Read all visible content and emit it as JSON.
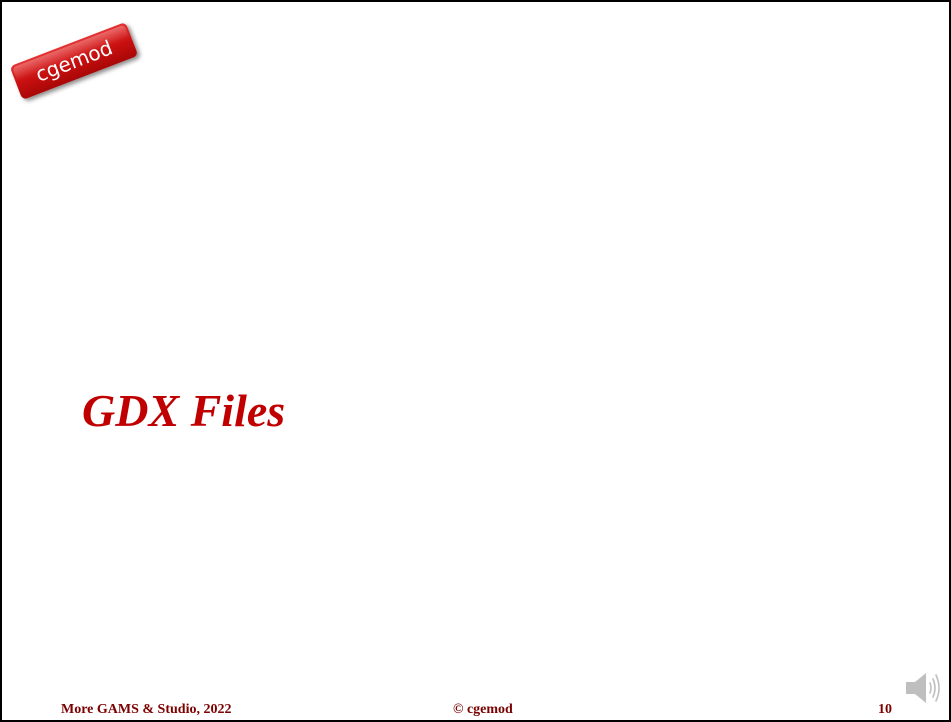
{
  "logo": {
    "text": "cgemod",
    "color": "#c81010"
  },
  "slide": {
    "title": "GDX Files",
    "title_color": "#c00000"
  },
  "footer": {
    "left": "More GAMS & Studio, 2022",
    "center": "© cgemod",
    "page_number": "10",
    "color": "#7b0000"
  },
  "icons": {
    "audio": "speaker-icon"
  }
}
